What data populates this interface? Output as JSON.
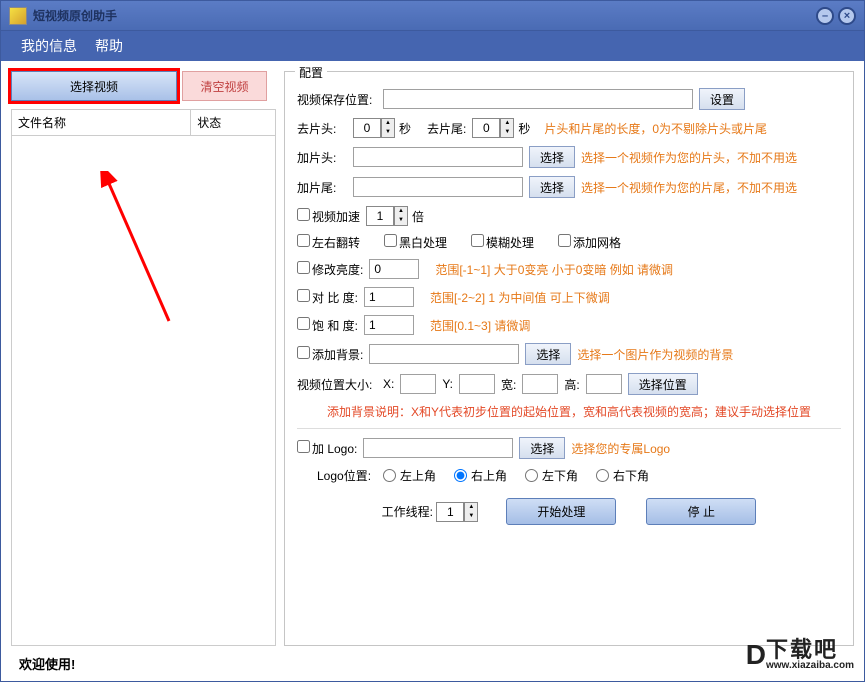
{
  "titlebar": {
    "title": "短视频原创助手"
  },
  "menu": {
    "myinfo": "我的信息",
    "help": "帮助"
  },
  "left": {
    "select_video": "选择视频",
    "clear_video": "清空视频",
    "col_filename": "文件名称",
    "col_status": "状态"
  },
  "config": {
    "group_label": "配置",
    "save_location_label": "视频保存位置:",
    "save_location_value": "",
    "btn_set": "设置",
    "trim_head_label": "去片头:",
    "trim_head_value": "0",
    "trim_tail_label": "去片尾:",
    "trim_tail_value": "0",
    "unit_sec": "秒",
    "trim_hint": "片头和片尾的长度，0为不剔除片头或片尾",
    "add_head_label": "加片头:",
    "add_head_value": "",
    "btn_choose": "选择",
    "add_head_hint": "选择一个视频作为您的片头，不加不用选",
    "add_tail_label": "加片尾:",
    "add_tail_value": "",
    "add_tail_hint": "选择一个视频作为您的片尾，不加不用选",
    "speed_label": "视频加速",
    "speed_value": "1",
    "speed_unit": "倍",
    "flip_label": "左右翻转",
    "bw_label": "黑白处理",
    "blur_label": "模糊处理",
    "grid_label": "添加网格",
    "brightness_label": "修改亮度:",
    "brightness_value": "0",
    "brightness_hint": "范围[-1~1]    大于0变亮 小于0变暗  例如 请微调",
    "contrast_label": "对 比  度:",
    "contrast_value": "1",
    "contrast_hint": "范围[-2~2]   1 为中间值  可上下微调",
    "saturation_label": "饱 和  度:",
    "saturation_value": "1",
    "saturation_hint": "范围[0.1~3]   请微调",
    "bg_label": "添加背景:",
    "bg_value": "",
    "bg_hint": "选择一个图片作为视频的背景",
    "pos_label": "视频位置大小:",
    "pos_x": "X:",
    "pos_y": "Y:",
    "pos_w": "宽:",
    "pos_h": "高:",
    "btn_choose_pos": "选择位置",
    "bg_note": "添加背景说明：X和Y代表初步位置的起始位置，宽和高代表视频的宽高；建议手动选择位置",
    "logo_label": "加 Logo:",
    "logo_value": "",
    "logo_hint": "选择您的专属Logo",
    "logo_pos_label": "Logo位置:",
    "logo_tl": "左上角",
    "logo_tr": "右上角",
    "logo_bl": "左下角",
    "logo_br": "右下角",
    "worker_label": "工作线程:",
    "worker_value": "1",
    "btn_start": "开始处理",
    "btn_stop": "停    止"
  },
  "status": "欢迎使用!",
  "watermark": {
    "pre": "D",
    "cn": "下载吧",
    "url": "www.xiazaiba.com"
  }
}
